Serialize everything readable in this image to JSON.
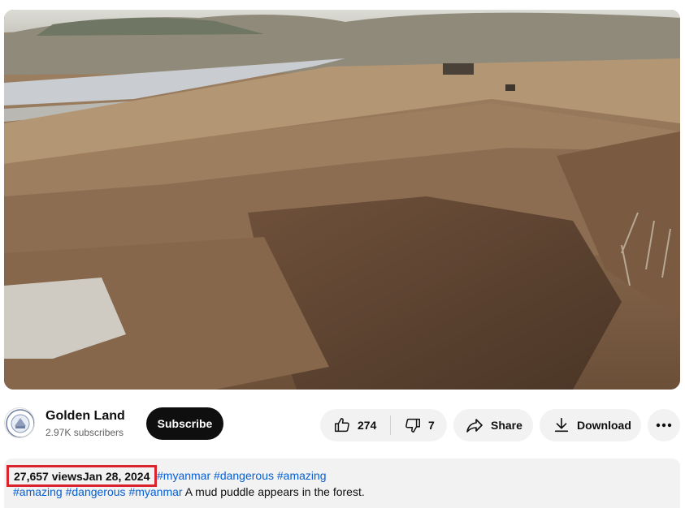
{
  "video": {
    "scene_description_icon": "video-frame-icon"
  },
  "channel": {
    "name": "Golden Land",
    "subscribers": "2.97K subscribers",
    "subscribe_label": "Subscribe"
  },
  "actions": {
    "like_count": "274",
    "dislike_count": "7",
    "share_label": "Share",
    "download_label": "Download",
    "more_icon": "more-horizontal-icon"
  },
  "description": {
    "views": "27,657 views",
    "date": "Jan 28, 2024",
    "top_tags": [
      "#myanmar",
      "#dangerous",
      "#amazing"
    ],
    "line_tags": [
      "#amazing",
      "#dangerous",
      "#myanmar"
    ],
    "text": "A mud puddle appears in the forest."
  },
  "colors": {
    "highlight": "#d9232d",
    "link": "#065fd4",
    "pill_bg": "#f2f2f2"
  }
}
